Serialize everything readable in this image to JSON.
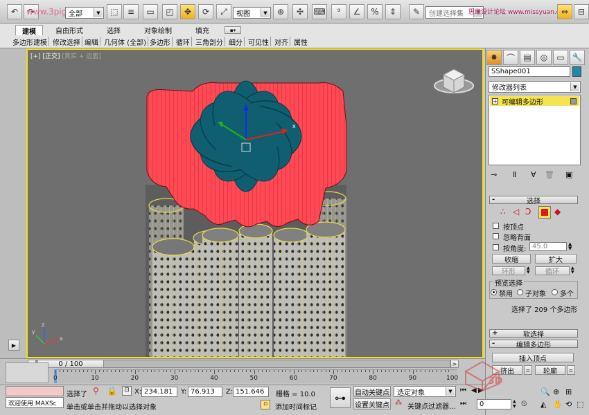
{
  "toolbar": {
    "selection_filter": "全部",
    "ref_coord": "视图",
    "named_selection_placeholder": "创建选择集",
    "watermark_left": "www.3pigs.com",
    "watermark_right": "思缘设计论坛 www.missyuan.com"
  },
  "ribbon": {
    "tabs": [
      "建模",
      "自由形式",
      "选择",
      "对象绘制",
      "填充"
    ],
    "subtabs": [
      "多边形建模",
      "修改选择",
      "编辑",
      "几何体 (全部)",
      "多边形",
      "循环",
      "三角剖分",
      "细分",
      "可见性",
      "对齐",
      "属性"
    ]
  },
  "viewport": {
    "label_plus": "[+]",
    "label_view": "[正交]",
    "label_shading": "[真实 + 边面]",
    "axis_x": "x",
    "axis_y": "y",
    "axis_z": "z",
    "gizmo_x": "x"
  },
  "command_panel": {
    "object_name": "SShape001",
    "name_color": "#1a8aa8",
    "modifier_list": "修改器列表",
    "stack_item": "可编辑多边形",
    "selection": {
      "header": "选择",
      "by_vertex": "按顶点",
      "ignore_backfacing": "忽略背面",
      "by_angle": "按角度:",
      "angle_value": "45.0",
      "shrink": "收缩",
      "grow": "扩大",
      "ring": "环形",
      "loop": "循环",
      "preview_title": "预览选择",
      "preview_off": "禁用",
      "preview_subobj": "子对象",
      "preview_multi": "多个",
      "status": "选择了 209 个多边形"
    },
    "soft_selection": "软选择",
    "edit_polygons": "编辑多边形",
    "insert_vertex": "插入顶点",
    "extrude": "挤出",
    "outline": "轮廓"
  },
  "timeline": {
    "frame_label": "0 / 100",
    "ticks": [
      "0",
      "10",
      "20",
      "30",
      "40",
      "50",
      "60",
      "70",
      "80",
      "90",
      "100"
    ]
  },
  "statusbar": {
    "welcome": "欢迎使用 MAXSc",
    "selected": "选择了",
    "x_label": "X:",
    "x_value": "234.181",
    "y_label": "Y:",
    "y_value": "76.913",
    "z_label": "Z:",
    "z_value": "151.646",
    "grid": "栅格 = 10.0",
    "prompt": "单击或单击并拖动以选择对象",
    "add_time_tag": "添加时间标记",
    "auto_key": "自动关键点",
    "set_key": "设置关键点",
    "selected_object": "选定对象",
    "key_filters": "关键点过滤器...",
    "frame_field": "0"
  },
  "colors": {
    "flower_top": "#0f5f70",
    "petal_side": "#ff4a55",
    "wire": "#e8d84a",
    "viewport_bg": "#6f6f6f",
    "selection_border": "#f0e020"
  }
}
